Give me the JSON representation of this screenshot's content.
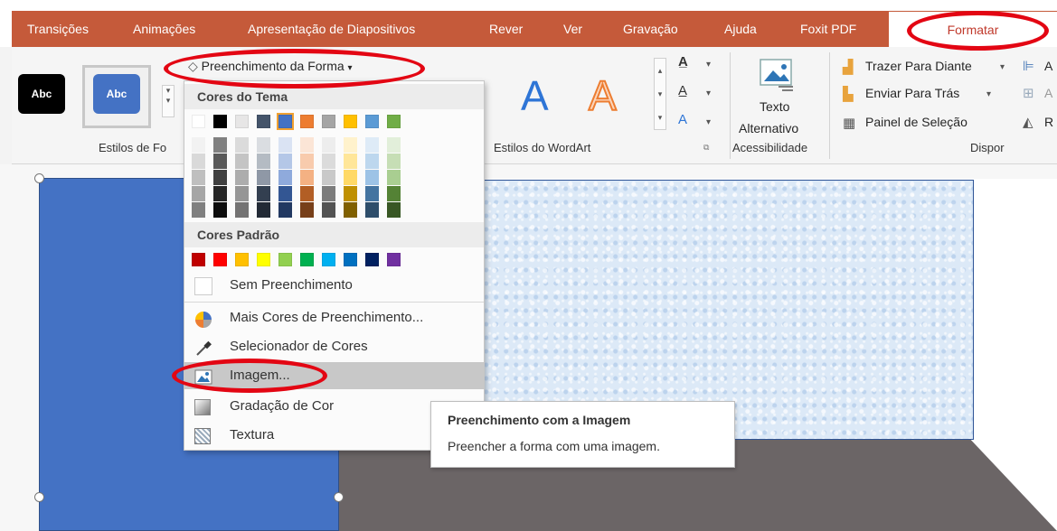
{
  "tabs": [
    {
      "label": "Transições"
    },
    {
      "label": "Animações"
    },
    {
      "label": "Apresentação de Diapositivos"
    },
    {
      "label": "Rever"
    },
    {
      "label": "Ver"
    },
    {
      "label": "Gravação"
    },
    {
      "label": "Ajuda"
    },
    {
      "label": "Foxit PDF"
    },
    {
      "label": "Formatar"
    }
  ],
  "ribbon": {
    "abc1": "Abc",
    "abc2": "Abc",
    "shape_fill_button": "Preenchimento da Forma",
    "wordart_letter": "A",
    "group_shape_styles": "Estilos de Fo",
    "group_wordart": "Estilos do WordArt",
    "alt_text_line1": "Texto",
    "alt_text_line2": "Alternativo",
    "group_accessibility": "Acessibilidade",
    "bring_forward": "Trazer Para Diante",
    "send_backward": "Enviar Para Trás",
    "selection_pane": "Painel de Seleção",
    "group_arrange": "Dispor",
    "cut_a": "A",
    "cut_r": "R"
  },
  "menu": {
    "theme_colors_header": "Cores do Tema",
    "standard_colors_header": "Cores Padrão",
    "theme_colors": [
      "#ffffff",
      "#000000",
      "#e7e6e6",
      "#44546a",
      "#4472c4",
      "#ed7d31",
      "#a5a5a5",
      "#ffc000",
      "#5b9bd5",
      "#70ad47"
    ],
    "standard_colors": [
      "#c00000",
      "#ff0000",
      "#ffc000",
      "#ffff00",
      "#92d050",
      "#00b050",
      "#00b0f0",
      "#0070c0",
      "#002060",
      "#7030a0"
    ],
    "items": {
      "no_fill": "Sem Preenchimento",
      "more_colors": "Mais Cores de Preenchimento...",
      "eyedropper": "Selecionador de Cores",
      "picture": "Imagem...",
      "gradient": "Gradação de Cor",
      "texture": "Textura"
    }
  },
  "tooltip": {
    "title": "Preenchimento com a Imagem",
    "description": "Preencher a forma com uma imagem."
  },
  "colors": {
    "ribbon_tab": "#c55a3a",
    "highlight_oval": "#e30613",
    "shape_blue": "#4472c4",
    "shape_gray": "#6b6566"
  }
}
